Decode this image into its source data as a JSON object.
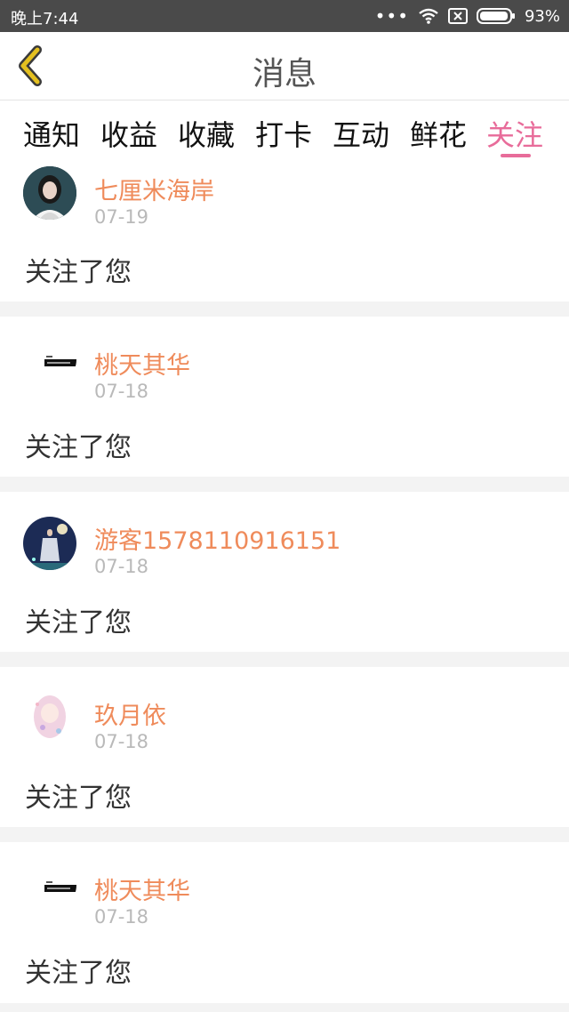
{
  "status": {
    "time": "晚上7:44",
    "dots": "•••",
    "battery": "93%"
  },
  "header": {
    "title": "消息",
    "back_icon": "chevron-left-icon",
    "accent_color": "#e4c020"
  },
  "tabs": [
    {
      "label": "通知",
      "active": false
    },
    {
      "label": "收益",
      "active": false
    },
    {
      "label": "收藏",
      "active": false
    },
    {
      "label": "打卡",
      "active": false
    },
    {
      "label": "互动",
      "active": false
    },
    {
      "label": "鲜花",
      "active": false
    },
    {
      "label": "关注",
      "active": true
    }
  ],
  "colors": {
    "active_tab": "#e86c9a",
    "username": "#ef8b5b",
    "date": "#b9b9b9"
  },
  "messages": [
    {
      "user": "七厘米海岸",
      "date": "07-19",
      "text": "关注了您",
      "avatar": "girl-portrait-avatar"
    },
    {
      "user": "桃天其华",
      "date": "07-18",
      "text": "关注了您",
      "avatar": "card-image-avatar"
    },
    {
      "user": "游客1578110916151",
      "date": "07-18",
      "text": "关注了您",
      "avatar": "game-character-avatar"
    },
    {
      "user": "玖月依",
      "date": "07-18",
      "text": "关注了您",
      "avatar": "anime-girl-avatar"
    },
    {
      "user": "桃天其华",
      "date": "07-18",
      "text": "关注了您",
      "avatar": "card-image-avatar"
    }
  ]
}
